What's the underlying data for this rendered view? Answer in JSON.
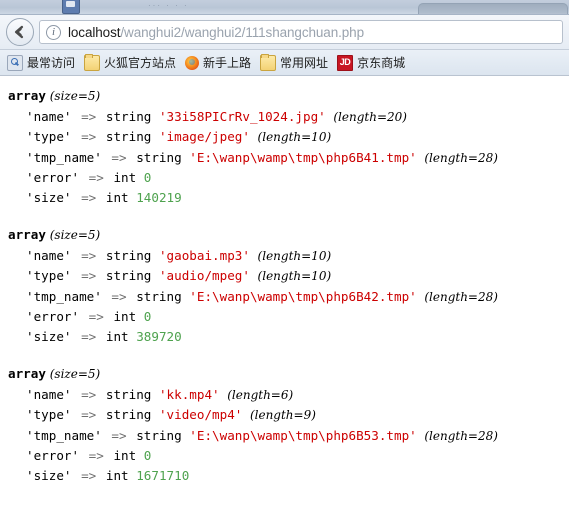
{
  "browser": {
    "back_button": "Back",
    "identity_icon": "i",
    "url": {
      "host": "localhost",
      "path": "/wanghui2/wanghui2/111shangchuan.php",
      "full": "localhost/wanghui2/wanghui2/111shangchuan.php"
    },
    "bookmarks": [
      {
        "label": "最常访问",
        "icon": "most-visited-icon"
      },
      {
        "label": "火狐官方站点",
        "icon": "folder-icon"
      },
      {
        "label": "新手上路",
        "icon": "firefox-icon"
      },
      {
        "label": "常用网址",
        "icon": "folder-icon"
      },
      {
        "label": "京东商城",
        "icon": "jd-icon",
        "icon_text": "JD"
      }
    ]
  },
  "page": {
    "dumps": [
      {
        "header": "array",
        "size_label": "(size=5)",
        "rows": [
          {
            "key": "'name'",
            "arrow": "=>",
            "type": "string",
            "value": "'33i58PICrRv_1024.jpg'",
            "value_kind": "string",
            "length": "(length=20)"
          },
          {
            "key": "'type'",
            "arrow": "=>",
            "type": "string",
            "value": "'image/jpeg'",
            "value_kind": "string",
            "length": "(length=10)"
          },
          {
            "key": "'tmp_name'",
            "arrow": "=>",
            "type": "string",
            "value": "'E:\\wanp\\wamp\\tmp\\php6B41.tmp'",
            "value_kind": "string",
            "length": "(length=28)"
          },
          {
            "key": "'error'",
            "arrow": "=>",
            "type": "int",
            "value": "0",
            "value_kind": "int",
            "length": ""
          },
          {
            "key": "'size'",
            "arrow": "=>",
            "type": "int",
            "value": "140219",
            "value_kind": "int",
            "length": ""
          }
        ]
      },
      {
        "header": "array",
        "size_label": "(size=5)",
        "rows": [
          {
            "key": "'name'",
            "arrow": "=>",
            "type": "string",
            "value": "'gaobai.mp3'",
            "value_kind": "string",
            "length": "(length=10)"
          },
          {
            "key": "'type'",
            "arrow": "=>",
            "type": "string",
            "value": "'audio/mpeg'",
            "value_kind": "string",
            "length": "(length=10)"
          },
          {
            "key": "'tmp_name'",
            "arrow": "=>",
            "type": "string",
            "value": "'E:\\wanp\\wamp\\tmp\\php6B42.tmp'",
            "value_kind": "string",
            "length": "(length=28)"
          },
          {
            "key": "'error'",
            "arrow": "=>",
            "type": "int",
            "value": "0",
            "value_kind": "int",
            "length": ""
          },
          {
            "key": "'size'",
            "arrow": "=>",
            "type": "int",
            "value": "389720",
            "value_kind": "int",
            "length": ""
          }
        ]
      },
      {
        "header": "array",
        "size_label": "(size=5)",
        "rows": [
          {
            "key": "'name'",
            "arrow": "=>",
            "type": "string",
            "value": "'kk.mp4'",
            "value_kind": "string",
            "length": "(length=6)"
          },
          {
            "key": "'type'",
            "arrow": "=>",
            "type": "string",
            "value": "'video/mp4'",
            "value_kind": "string",
            "length": "(length=9)"
          },
          {
            "key": "'tmp_name'",
            "arrow": "=>",
            "type": "string",
            "value": "'E:\\wanp\\wamp\\tmp\\php6B53.tmp'",
            "value_kind": "string",
            "length": "(length=28)"
          },
          {
            "key": "'error'",
            "arrow": "=>",
            "type": "int",
            "value": "0",
            "value_kind": "int",
            "length": ""
          },
          {
            "key": "'size'",
            "arrow": "=>",
            "type": "int",
            "value": "1671710",
            "value_kind": "int",
            "length": ""
          }
        ]
      }
    ]
  },
  "colors": {
    "string_value": "#cc0000",
    "int_value": "#4ea24e",
    "text": "#000000",
    "url_host": "#1b1b1b",
    "url_path": "#9aa3ae",
    "jd_badge": "#c81623"
  }
}
